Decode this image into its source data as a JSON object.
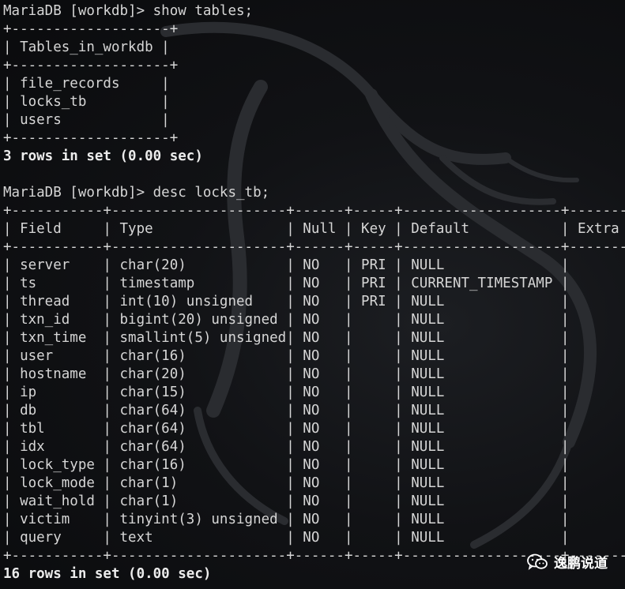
{
  "terminal": {
    "lines": [
      "MariaDB [workdb]> show tables;",
      "+-------------------+",
      "| Tables_in_workdb |",
      "+-------------------+",
      "| file_records     |",
      "| locks_tb         |",
      "| users            |",
      "+-------------------+",
      "3 rows in set (0.00 sec)",
      "",
      "MariaDB [workdb]> desc locks_tb;",
      "+-----------+---------------------+------+-----+-------------------+-------+",
      "| Field     | Type                | Null | Key | Default           | Extra |",
      "+-----------+---------------------+------+-----+-------------------+-------+",
      "| server    | char(20)            | NO   | PRI | NULL              |       |",
      "| ts        | timestamp           | NO   | PRI | CURRENT_TIMESTAMP |       |",
      "| thread    | int(10) unsigned    | NO   | PRI | NULL              |       |",
      "| txn_id    | bigint(20) unsigned | NO   |     | NULL              |       |",
      "| txn_time  | smallint(5) unsigned| NO   |     | NULL              |       |",
      "| user      | char(16)            | NO   |     | NULL              |       |",
      "| hostname  | char(20)            | NO   |     | NULL              |       |",
      "| ip        | char(15)            | NO   |     | NULL              |       |",
      "| db        | char(64)            | NO   |     | NULL              |       |",
      "| tbl       | char(64)            | NO   |     | NULL              |       |",
      "| idx       | char(64)            | NO   |     | NULL              |       |",
      "| lock_type | char(16)            | NO   |     | NULL              |       |",
      "| lock_mode | char(1)             | NO   |     | NULL              |       |",
      "| wait_hold | char(1)             | NO   |     | NULL              |       |",
      "| victim    | tinyint(3) unsigned | NO   |     | NULL              |       |",
      "| query     | text                | NO   |     | NULL              |       |",
      "+-----------+---------------------+------+-----+-------------------+-------+",
      "16 rows in set (0.00 sec)"
    ]
  },
  "watermark": {
    "text": "逸鹏说道",
    "icon": "wechat-icon"
  }
}
